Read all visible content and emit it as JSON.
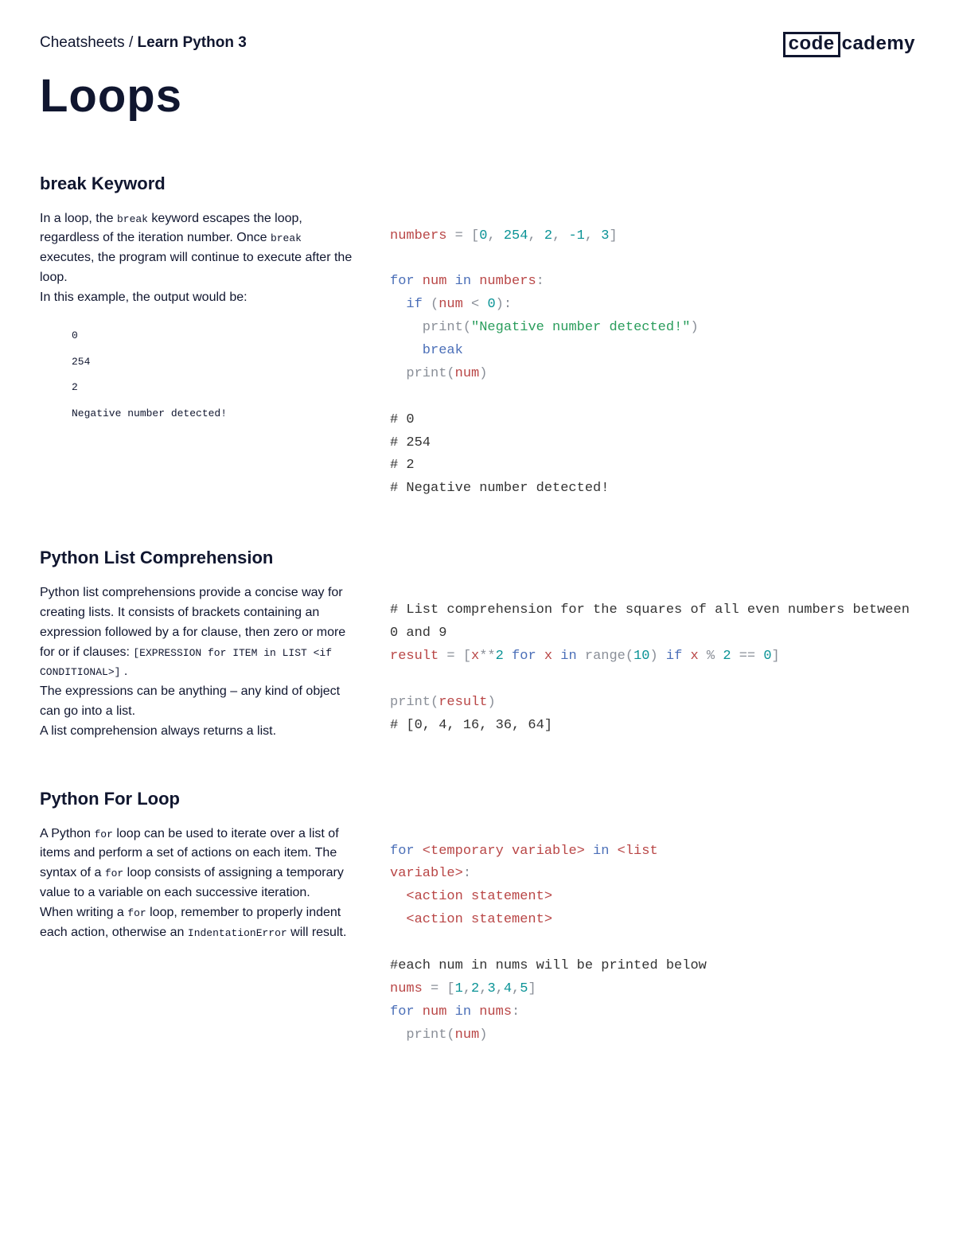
{
  "breadcrumb": {
    "prefix": "Cheatsheets / ",
    "current": "Learn Python 3"
  },
  "logo": {
    "box": "code",
    "rest": "cademy"
  },
  "title": "Loops",
  "s1": {
    "heading": "break Keyword",
    "p1a": "In a loop, the ",
    "p1code1": "break",
    "p1b": " keyword escapes the loop, regardless of the iteration number. Once ",
    "p1code2": "break",
    "p1c": " executes, the program will continue to execute after the loop.",
    "p2": "In this example, the output would be:",
    "out": [
      "0",
      "254",
      "2",
      "Negative number detected!"
    ],
    "code": {
      "l1_a": "numbers",
      "l1_b": " = [",
      "l1_c": "0",
      "l1_d": ", ",
      "l1_e": "254",
      "l1_f": ", ",
      "l1_g": "2",
      "l1_h": ", ",
      "l1_i": "-1",
      "l1_j": ", ",
      "l1_k": "3",
      "l1_l": "]",
      "l3_a": "for",
      "l3_b": " num ",
      "l3_c": "in",
      "l3_d": " numbers",
      "l3_e": ":",
      "l4_a": "  if",
      "l4_b": " (",
      "l4_c": "num",
      "l4_d": " < ",
      "l4_e": "0",
      "l4_f": "):",
      "l5_a": "    print",
      "l5_b": "(",
      "l5_c": "\"Negative number detected!\"",
      "l5_d": ")",
      "l6_a": "    break",
      "l7_a": "  print",
      "l7_b": "(",
      "l7_c": "num",
      "l7_d": ")",
      "l9": "# 0",
      "l10": "# 254",
      "l11": "# 2",
      "l12": "# Negative number detected!"
    }
  },
  "s2": {
    "heading": "Python List Comprehension",
    "p1a": "Python list comprehensions provide a concise way for creating lists. It consists of brackets containing an expression followed by a for clause, then zero or more for or if clauses: ",
    "p1code": "[EXPRESSION for ITEM in LIST <if CONDITIONAL>]",
    "p1b": " .",
    "p2": "The expressions can be anything – any kind of object can go into a list.",
    "p3": "A list comprehension always returns a list.",
    "code": {
      "l1": "# List comprehension for the squares of all even numbers between 0 and 9",
      "l2_a": "result",
      "l2_b": " = [",
      "l2_c": "x",
      "l2_d": "**",
      "l2_e": "2",
      "l2_f": " for",
      "l2_g": " x ",
      "l2_h": "in",
      "l2_i": " range",
      "l2_j": "(",
      "l2_k": "10",
      "l2_l": ") ",
      "l2_m": "if",
      "l2_n": " x ",
      "l2_o": "%",
      "l2_p": " 2",
      "l3_a": " == ",
      "l3_b": "0",
      "l3_c": "]",
      "l5_a": "print",
      "l5_b": "(",
      "l5_c": "result",
      "l5_d": ")",
      "l6": "# [0, 4, 16, 36, 64]"
    }
  },
  "s3": {
    "heading": "Python For Loop",
    "p1a": "A Python ",
    "p1code1": "for",
    "p1b": " loop can be used to iterate over a list of items and perform a set of actions on each item. The syntax of a ",
    "p1code2": "for",
    "p1c": " loop consists of assigning a temporary value to a variable on each successive iteration.",
    "p2a": "When writing a ",
    "p2code1": "for",
    "p2b": " loop, remember to properly indent each action, otherwise an ",
    "p2code2": "IndentationError",
    "p2c": " will result.",
    "code": {
      "l1_a": "for",
      "l1_b": " <temporary variable> ",
      "l1_c": "in",
      "l1_d": " <list ",
      "l2_a": "variable>",
      "l2_b": ":",
      "l3": "  <action statement>",
      "l4": "  <action statement>",
      "l6": "#each num in nums will be printed below",
      "l7_a": "nums",
      "l7_b": " = [",
      "l7_c": "1",
      "l7_d": ",",
      "l7_e": "2",
      "l7_f": ",",
      "l7_g": "3",
      "l7_h": ",",
      "l7_i": "4",
      "l7_j": ",",
      "l7_k": "5",
      "l7_l": "]",
      "l8_a": "for",
      "l8_b": " num ",
      "l8_c": "in",
      "l8_d": " nums",
      "l8_e": ":",
      "l9_a": "  print",
      "l9_b": "(",
      "l9_c": "num",
      "l9_d": ")"
    }
  }
}
